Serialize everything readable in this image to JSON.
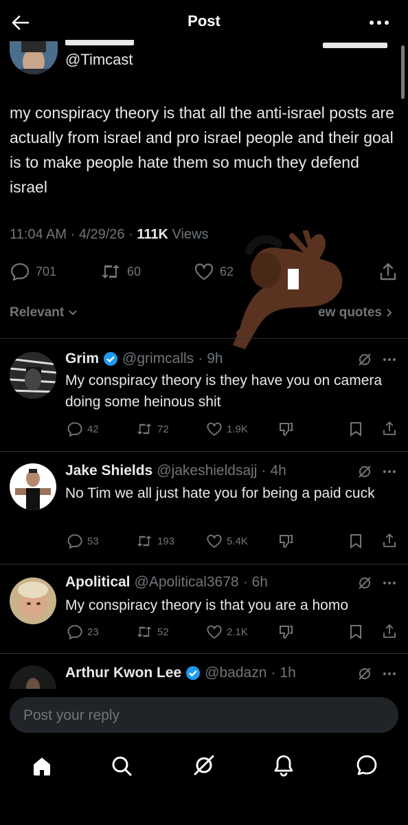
{
  "header": {
    "title": "Post"
  },
  "author": {
    "handle": "@Timcast"
  },
  "post": {
    "text": "my conspiracy theory is that all the anti-israel posts are actually from israel and pro israel people and their goal is to make people hate them so much they defend israel",
    "time": "11:04 AM",
    "date": "4/29/26",
    "views_count": "111K",
    "views_label": "Views",
    "replies": "701",
    "reposts": "60",
    "likes": "62"
  },
  "filter": {
    "relevant": "Relevant",
    "quotes": "ew quotes"
  },
  "replies": [
    {
      "name": "Grim",
      "handle": "@grimcalls",
      "time": "9h",
      "text": "My conspiracy theory is they have you on camera doing some heinous shit",
      "replies": "42",
      "reposts": "72",
      "likes": "1.9K"
    },
    {
      "name": "Jake Shields",
      "handle": "@jakeshieldsajj",
      "time": "4h",
      "text": "No Tim we all just hate you for being a paid cuck",
      "replies": "53",
      "reposts": "193",
      "likes": "5.4K"
    },
    {
      "name": "Apolitical",
      "handle": "@Apolitical3678",
      "time": "6h",
      "text": "My conspiracy theory is that you are a homo",
      "replies": "23",
      "reposts": "52",
      "likes": "2.1K"
    },
    {
      "name": "Arthur Kwon Lee",
      "handle": "@badazn",
      "time": "1h"
    }
  ],
  "composer": {
    "placeholder": "Post your reply"
  },
  "colors": {
    "verified": "#1d9bf0",
    "background": "#000000",
    "muted": "#71767b"
  }
}
